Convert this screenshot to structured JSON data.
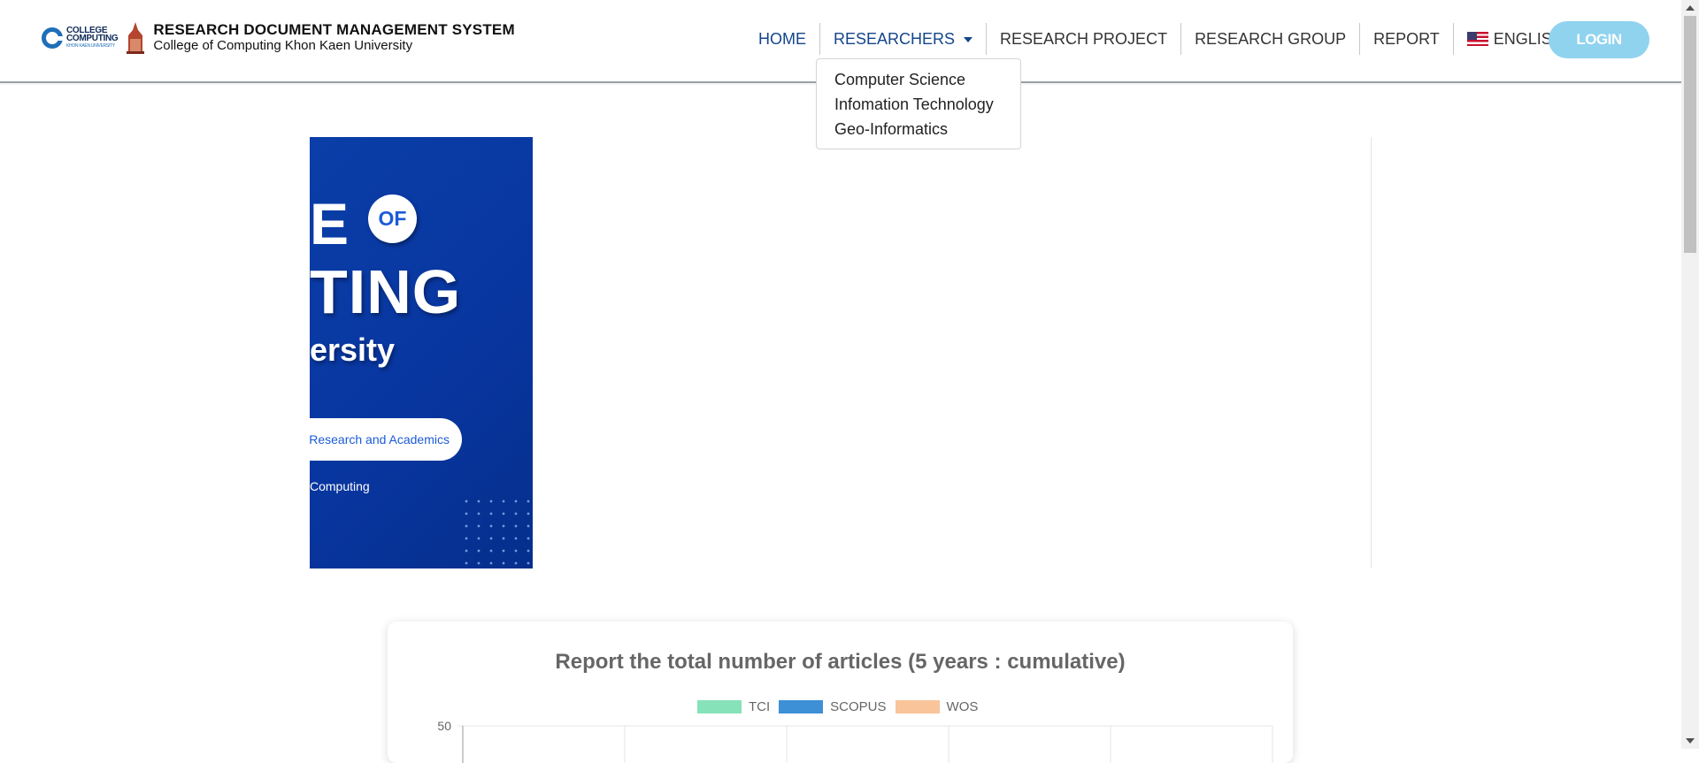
{
  "header": {
    "logo_lines": [
      "COLLEGE",
      "COMPUTING"
    ],
    "logo_of": "OF",
    "logo_sub": "KHON KAEN UNIVERSITY",
    "title": "RESEARCH DOCUMENT MANAGEMENT SYSTEM",
    "subtitle": "College of Computing Khon Kaen University"
  },
  "nav": {
    "home": "HOME",
    "researchers": "RESEARCHERS",
    "research_project": "RESEARCH PROJECT",
    "research_group": "RESEARCH GROUP",
    "report": "REPORT",
    "language": "ENGLISH",
    "login": "LOGIN",
    "researchers_menu": [
      "Computer Science",
      "Infomation Technology",
      "Geo-Informatics"
    ]
  },
  "banner": {
    "line1": "E",
    "of_badge": "OF",
    "line2": "TING",
    "line3": "ersity",
    "pill": "Research and Academics",
    "line5": "Computing"
  },
  "report": {
    "title": "Report the total number of articles (5 years : cumulative)"
  },
  "chart_data": {
    "type": "bar",
    "title": "Report the total number of articles (5 years : cumulative)",
    "series": [
      {
        "name": "TCI",
        "color": "#86e2b8"
      },
      {
        "name": "SCOPUS",
        "color": "#3d8fd6"
      },
      {
        "name": "WOS",
        "color": "#f9c49a"
      }
    ],
    "ytick_top": "50",
    "ylim": [
      0,
      50
    ],
    "grid": true,
    "legend_position": "top"
  },
  "colors": {
    "nav_active": "#14468a",
    "login_bg": "#8fd3ef",
    "banner_bg": "#0b3ea8"
  }
}
